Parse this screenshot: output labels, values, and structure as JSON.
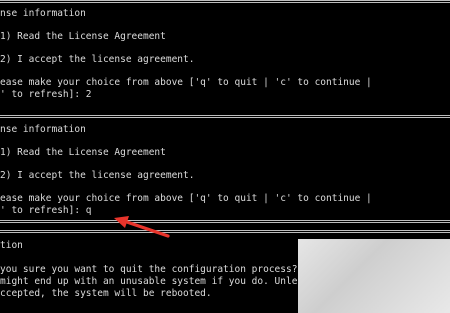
{
  "terminal": {
    "lines": [
      "nse information",
      "1) Read the License Agreement",
      "2) I accept the license agreement.",
      "ease make your choice from above ['q' to quit | 'c' to continue |",
      "' to refresh]: 2",
      "nse information",
      "1) Read the License Agreement",
      "2) I accept the license agreement.",
      "ease make your choice from above ['q' to quit | 'c' to continue |",
      "' to refresh]: q",
      "tion",
      "you sure you want to quit the configuration process?",
      "might end up with an unusable system if you do. Unle",
      "ccepted, the system will be rebooted."
    ]
  },
  "annotation": {
    "arrow_color": "#e8342b"
  }
}
